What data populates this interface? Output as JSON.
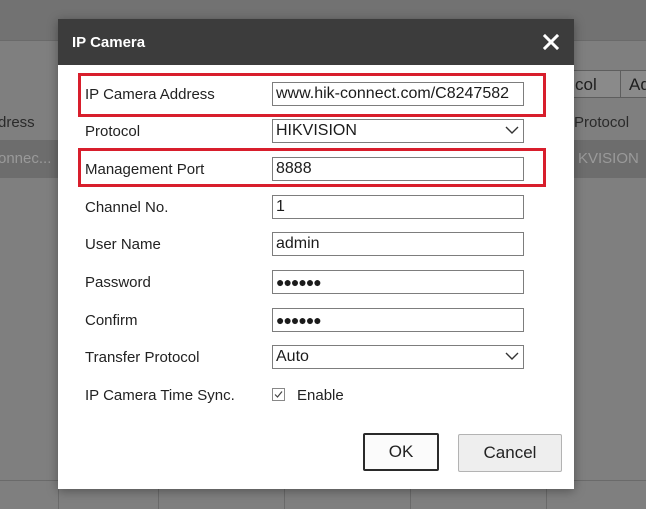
{
  "background": {
    "buttons": [
      "col",
      "Ad"
    ],
    "header_cells": [
      "dress",
      "Protocol"
    ],
    "row_cells": [
      "onnec...",
      "KVISION"
    ]
  },
  "dialog": {
    "title": "IP Camera",
    "close_icon": "close-icon",
    "fields": {
      "ip_address": {
        "label": "IP Camera Address",
        "value": "www.hik-connect.com/C8247582"
      },
      "protocol": {
        "label": "Protocol",
        "value": "HIKVISION"
      },
      "management_port": {
        "label": "Management Port",
        "value": "8888"
      },
      "channel_no": {
        "label": "Channel No.",
        "value": "1"
      },
      "user_name": {
        "label": "User Name",
        "value": "admin"
      },
      "password": {
        "label": "Password",
        "value": "●●●●●●"
      },
      "confirm": {
        "label": "Confirm",
        "value": "●●●●●●"
      },
      "transfer_protocol": {
        "label": "Transfer Protocol",
        "value": "Auto"
      },
      "time_sync": {
        "label": "IP Camera Time Sync.",
        "checkbox_label": "Enable",
        "checked": true
      }
    },
    "buttons": {
      "ok": "OK",
      "cancel": "Cancel"
    },
    "highlight_color": "#d81e2c"
  }
}
